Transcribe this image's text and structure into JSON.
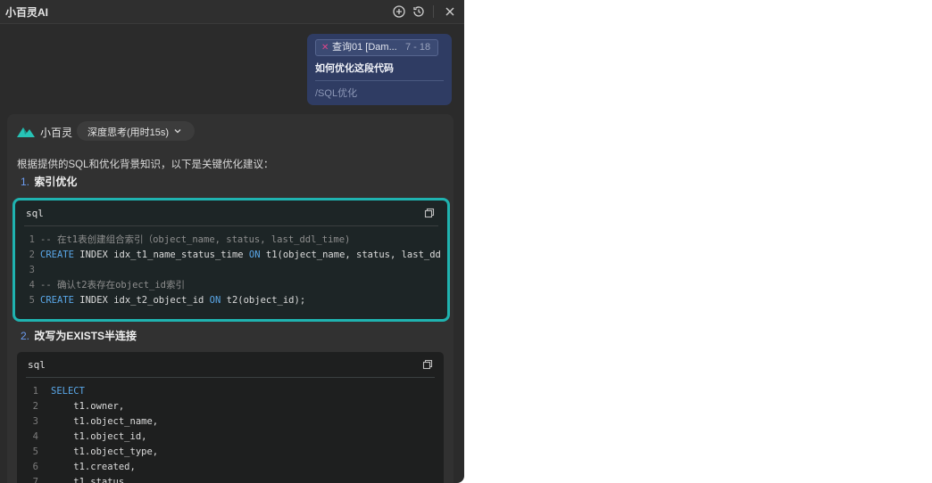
{
  "window": {
    "title": "小百灵AI",
    "icons": [
      "new-chat-icon",
      "history-icon",
      "close-icon"
    ]
  },
  "user_message": {
    "ref_chip": {
      "name": "查询01 [Dam...",
      "range": "7 - 18"
    },
    "question": "如何优化这段代码",
    "command": "/SQL优化"
  },
  "assistant": {
    "name": "小百灵",
    "thinking_label": "深度思考(用时15s)",
    "intro": "根据提供的SQL和优化背景知识，以下是关键优化建议：",
    "sections": [
      {
        "number": "1.",
        "title": "索引优化",
        "code": {
          "lang": "sql",
          "lines": [
            {
              "n": "1",
              "parts": [
                {
                  "t": "-- 在t1表创建组合索引（object_name, status, last_ddl_time)",
                  "c": "cm"
                }
              ]
            },
            {
              "n": "2",
              "parts": [
                {
                  "t": "CREATE",
                  "c": "kw"
                },
                {
                  "t": " INDEX idx_t1_name_status_time ",
                  "c": ""
                },
                {
                  "t": "ON",
                  "c": "kw"
                },
                {
                  "t": " t1(object_name, status, last_dd",
                  "c": ""
                }
              ]
            },
            {
              "n": "3",
              "parts": []
            },
            {
              "n": "4",
              "parts": [
                {
                  "t": "-- 确认t2表存在object_id索引",
                  "c": "cm"
                }
              ]
            },
            {
              "n": "5",
              "parts": [
                {
                  "t": "CREATE",
                  "c": "kw"
                },
                {
                  "t": " INDEX idx_t2_object_id ",
                  "c": ""
                },
                {
                  "t": "ON",
                  "c": "kw"
                },
                {
                  "t": " t2(object_id);",
                  "c": ""
                }
              ]
            }
          ]
        }
      },
      {
        "number": "2.",
        "title": "改写为EXISTS半连接",
        "code": {
          "lang": "sql",
          "lines": [
            {
              "n": "1",
              "parts": [
                {
                  "t": "SELECT",
                  "c": "kw"
                }
              ]
            },
            {
              "n": "2",
              "parts": [
                {
                  "t": "    t1.owner,",
                  "c": ""
                }
              ]
            },
            {
              "n": "3",
              "parts": [
                {
                  "t": "    t1.object_name,",
                  "c": ""
                }
              ]
            },
            {
              "n": "4",
              "parts": [
                {
                  "t": "    t1.object_id,",
                  "c": ""
                }
              ]
            },
            {
              "n": "5",
              "parts": [
                {
                  "t": "    t1.object_type,",
                  "c": ""
                }
              ]
            },
            {
              "n": "6",
              "parts": [
                {
                  "t": "    t1.created,",
                  "c": ""
                }
              ]
            },
            {
              "n": "7",
              "parts": [
                {
                  "t": "    t1.status,",
                  "c": ""
                }
              ]
            }
          ]
        }
      }
    ]
  },
  "colors": {
    "panel_bg": "#2b2b2b",
    "bubble_bg": "#2f3c63",
    "highlight_border": "#1fb3b0",
    "keyword": "#5aa7e8",
    "list_number": "#6b9cf0"
  }
}
